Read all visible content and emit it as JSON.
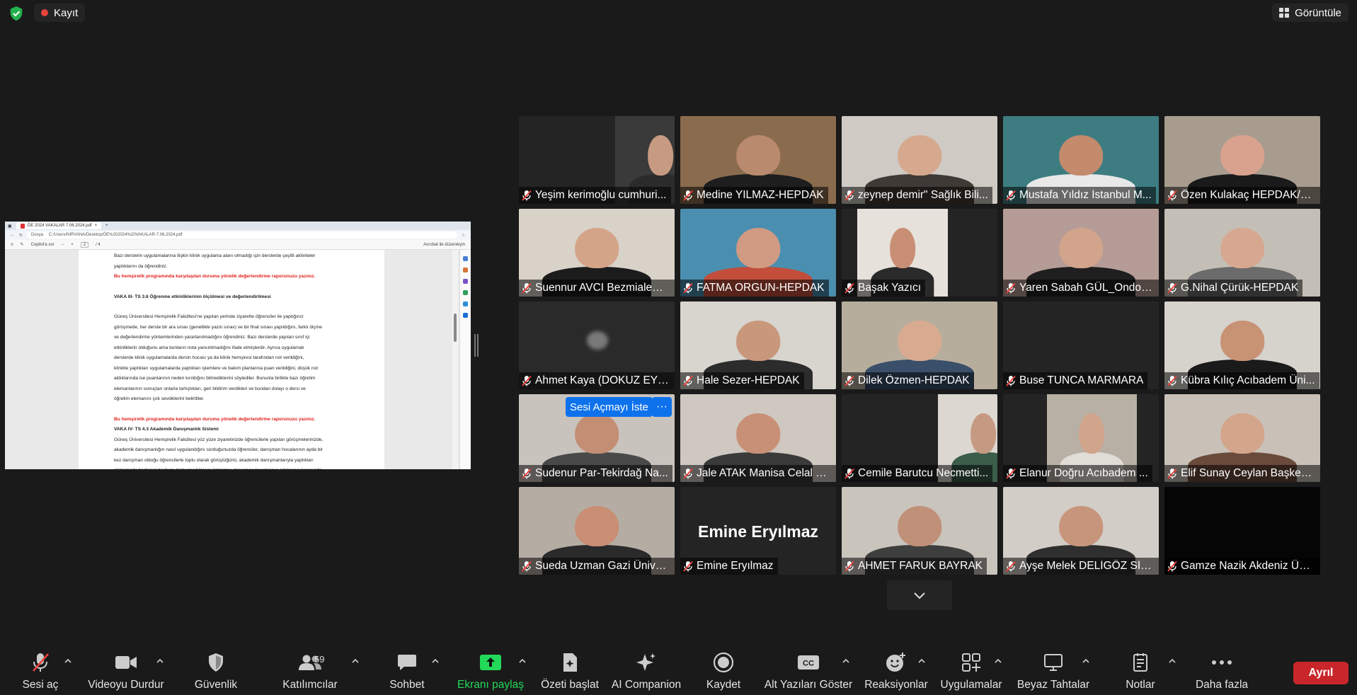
{
  "topbar": {
    "recording_label": "Kayıt",
    "view_label": "Görüntüle"
  },
  "shared_screen": {
    "tab_title": "ÖE 2024 VAKALAR 7.06.2024.pdf",
    "address_prefix": "Dosya",
    "address": "C:/Users/NIRVANA/Desktop/ÖE%202024%20VAKALAR-7.06.2024.pdf",
    "toolbar_search": "Copilot'a sor",
    "toolbar_page": "2",
    "toolbar_pages": "/ 4",
    "toolbar_acrobat": "Acrobat ile düzenleyin",
    "lines": [
      {
        "style": "normal",
        "text": "Bazı derslerin uygulamalarına ilişkin klinik uygulama alanı olmadığı için derslerde çeşitli aktiviteler"
      },
      {
        "style": "normal",
        "text": "yaptıklarını da öğrendiniz."
      },
      {
        "style": "red",
        "text": "Bu hemşirelik programında karşılaşılan duruma yönelik değerlendirme raporunuzu yazınız."
      },
      {
        "style": "gap",
        "text": ""
      },
      {
        "style": "bold",
        "text": "VAKA III- TS 3.6 Öğrenme etkinliklerinin ölçülmesi ve değerlendirilmesi"
      },
      {
        "style": "gap",
        "text": ""
      },
      {
        "style": "normal",
        "text": "Güneş Üniversitesi Hemşirelik Fakültesi'ne yapılan yerinde ziyarette öğrenciler ile yaptığınız"
      },
      {
        "style": "normal",
        "text": "görüşmede, her derste bir ara sınav (genellikle yazılı sınav) ve bir final sınavı yapıldığını, farklı ölçme"
      },
      {
        "style": "normal",
        "text": "ve değerlendirme yöntemlerinden yararlanılmadığını öğrendiniz. Bazı derslerde yapılan sınıf içi"
      },
      {
        "style": "normal",
        "text": "etkinliklerin olduğunu ama bunların nota yansıtılmadığını ifade etmişlerdir. Ayrıca uygulamalı"
      },
      {
        "style": "normal",
        "text": "derslerde klinik uygulamalarda dersin hocası ya da klinik hemşiresi tarafından not verildiğini,"
      },
      {
        "style": "normal",
        "text": "klinikte yaptıkları uygulamalarda yaptıkları işlemlere ve bakım planlarına puan verildiğini, düşük not"
      },
      {
        "style": "normal",
        "text": "aldıklarında ise puanlarının neden kırıldığını bilmediklerini söylediler. Bununla birlikte bazı öğretim"
      },
      {
        "style": "normal",
        "text": "elemanlarının sonuçları onlarla tartıştıkları, geri bildirim verdikleri ve bundan dolayı o dersi ve"
      },
      {
        "style": "normal",
        "text": "öğretim elemanını çok sevdiklerini belirttiler."
      },
      {
        "style": "gap",
        "text": ""
      },
      {
        "style": "red",
        "text": "Bu hemşirelik programında karşılaşılan duruma yönelik değerlendirme raporunuzu yazınız."
      },
      {
        "style": "bold",
        "text": "VAKA IV- TS 4.3  Akademik Danışmanlık Sistemi"
      },
      {
        "style": "normal",
        "text": "Güneş Üniversitesi Hemşirelik Fakültesi yüz yüze ziyaretinizde öğrencilerle yapılan görüşmelerinizde,"
      },
      {
        "style": "normal",
        "text": "akademik danışmanlığın nasıl uygulandığını sorduğunuzda öğrenciler, danışman hocalarının ayda bir"
      },
      {
        "style": "normal",
        "text": "kez danışman olduğu öğrencilerle toplu olarak görüştüğünü, akademik danışmanlarıyla yaptıkları"
      },
      {
        "style": "normal",
        "text": "görüşmede herhangi bir form doldurmadıklarını iletmişler, danışman hocalarının odalarının kapısında"
      }
    ]
  },
  "participants": [
    {
      "name": "Yeşim kerimoğlu cumhuri...",
      "kind": "video",
      "bg": "#3a3a3a",
      "skin": "#c79a82",
      "shirt": "#2b2b2b",
      "vw": 58,
      "vx": 62
    },
    {
      "name": "Medine YILMAZ-HEPDAK",
      "kind": "video",
      "bg": "#8a6b4e",
      "skin": "#b98a6d",
      "shirt": "#1e1e1e",
      "vw": 100,
      "vx": 0
    },
    {
      "name": "zeynep demir\" Sağlık Bili...",
      "kind": "video",
      "bg": "#cfcac4",
      "skin": "#d6a98e",
      "shirt": "#403a36",
      "vw": 100,
      "vx": 0
    },
    {
      "name": "Mustafa Yıldız İstanbul M...",
      "kind": "video",
      "bg": "#3d7d82",
      "skin": "#c38a6c",
      "shirt": "#e8e8e8",
      "vw": 100,
      "vx": 0
    },
    {
      "name": "Özen Kulakaç HEPDAK/OMÜ",
      "kind": "video",
      "bg": "#a89c8f",
      "skin": "#d9a28f",
      "shirt": "#1a1a1a",
      "vw": 100,
      "vx": 0
    },
    {
      "name": "Suennur AVCI Bezmialem V.Ü.",
      "kind": "video",
      "bg": "#d8d2c8",
      "skin": "#d4a488",
      "shirt": "#1c1c1c",
      "vw": 100,
      "vx": 0,
      "active": true
    },
    {
      "name": "FATMA ORGUN-HEPDAK",
      "kind": "video",
      "bg": "#4b8fb0",
      "skin": "#d19a82",
      "shirt": "#c24e3b",
      "vw": 100,
      "vx": 0
    },
    {
      "name": "Başak Yazıcı",
      "kind": "video",
      "bg": "#e6e1da",
      "skin": "#c98f74",
      "shirt": "#2a2a2a",
      "vw": 58,
      "vx": 10
    },
    {
      "name": "Yaren Sabah GÜL_Ondok...",
      "kind": "video",
      "bg": "#b59c96",
      "skin": "#d2a48c",
      "shirt": "#1f1f1f",
      "vw": 100,
      "vx": 0
    },
    {
      "name": "G.Nihal Çürük-HEPDAK",
      "kind": "video",
      "bg": "#c4bfb6",
      "skin": "#d7a890",
      "shirt": "#6b6b6b",
      "vw": 100,
      "vx": 0
    },
    {
      "name": "Ahmet Kaya (DOKUZ EYL...",
      "kind": "blur",
      "bg": "#2a2a2a"
    },
    {
      "name": "Hale Sezer-HEPDAK",
      "kind": "video",
      "bg": "#d8d4ce",
      "skin": "#c9977b",
      "shirt": "#2c2c2c",
      "vw": 100,
      "vx": 0
    },
    {
      "name": "Dilek Özmen-HEPDAK",
      "kind": "video",
      "bg": "#b7ad9c",
      "skin": "#d8ab91",
      "shirt": "#3a4f6a",
      "vw": 100,
      "vx": 0
    },
    {
      "name": "Buse TUNCA MARMARA",
      "kind": "empty",
      "bg": "#242424"
    },
    {
      "name": "Kübra Kılıç Acıbadem Üni...",
      "kind": "video",
      "bg": "#d6d2cc",
      "skin": "#c89275",
      "shirt": "#1a1a1a",
      "vw": 100,
      "vx": 0
    },
    {
      "name": "Sudenur Par-Tekirdağ Na...",
      "kind": "video",
      "bg": "#c9c3bd",
      "skin": "#c38f74",
      "shirt": "#494949",
      "vw": 100,
      "vx": 0,
      "hover": true
    },
    {
      "name": "Jale ATAK Manisa Celal Ba...",
      "kind": "video",
      "bg": "#cfc8c0",
      "skin": "#c89076",
      "shirt": "#3a3a3a",
      "vw": 100,
      "vx": 0
    },
    {
      "name": "Cemile Barutcu Necmetti...",
      "kind": "video",
      "bg": "#dcd7d0",
      "skin": "#c69a82",
      "shirt": "#3b5d4a",
      "vw": 58,
      "vx": 62
    },
    {
      "name": "Elanur Doğru Acıbadem ...",
      "kind": "video",
      "bg": "#b8b0a4",
      "skin": "#d1a48c",
      "shirt": "#e0dcd6",
      "vw": 58,
      "vx": 28
    },
    {
      "name": "Elif Sunay Ceylan Başkent...",
      "kind": "video",
      "bg": "#c9c1b8",
      "skin": "#d3a58b",
      "shirt": "#6a4a3a",
      "vw": 100,
      "vx": 0
    },
    {
      "name": "Sueda Uzman Gazi Ünive...",
      "kind": "video",
      "bg": "#b5aca3",
      "skin": "#c98e74",
      "shirt": "#2a2a2a",
      "vw": 100,
      "vx": 0
    },
    {
      "name": "Emine Eryılmaz",
      "kind": "name",
      "bg": "#242424"
    },
    {
      "name": "AHMET FARUK BAYRAK",
      "kind": "video",
      "bg": "#c9c4bc",
      "skin": "#c09078",
      "shirt": "#3e3e3e",
      "vw": 100,
      "vx": 0
    },
    {
      "name": "Ayşe Melek DELİGÖZ SİV...",
      "kind": "video",
      "bg": "#d2cdc6",
      "skin": "#c7957b",
      "shirt": "#2f2f2f",
      "vw": 100,
      "vx": 0
    },
    {
      "name": "Gamze Nazik Akdeniz Üni...",
      "kind": "empty",
      "bg": "#050505"
    }
  ],
  "hover_actions": {
    "ask_unmute": "Sesi Açmayı İste",
    "more": "···"
  },
  "bottombar": {
    "unmute": "Sesi aç",
    "stop_video": "Videoyu Durdur",
    "security": "Güvenlik",
    "participants": "Katılımcılar",
    "participants_count": "59",
    "chat": "Sohbet",
    "share_screen": "Ekranı paylaş",
    "summary": "Özeti başlat",
    "ai_companion": "AI Companion",
    "record": "Kaydet",
    "captions": "Alt Yazıları Göster",
    "cc_badge": "CC",
    "reactions": "Reaksiyonlar",
    "apps": "Uygulamalar",
    "whiteboards": "Beyaz Tahtalar",
    "notes": "Notlar",
    "more": "Daha fazla",
    "leave": "Ayrıl"
  },
  "colors": {
    "background": "#1a1a1a",
    "tile": "#242424",
    "active_border": "#d7e24c",
    "accent_blue": "#0e72ed",
    "share_green": "#23d959",
    "leave_red": "#c9262b",
    "muted_red": "#e8423d"
  }
}
